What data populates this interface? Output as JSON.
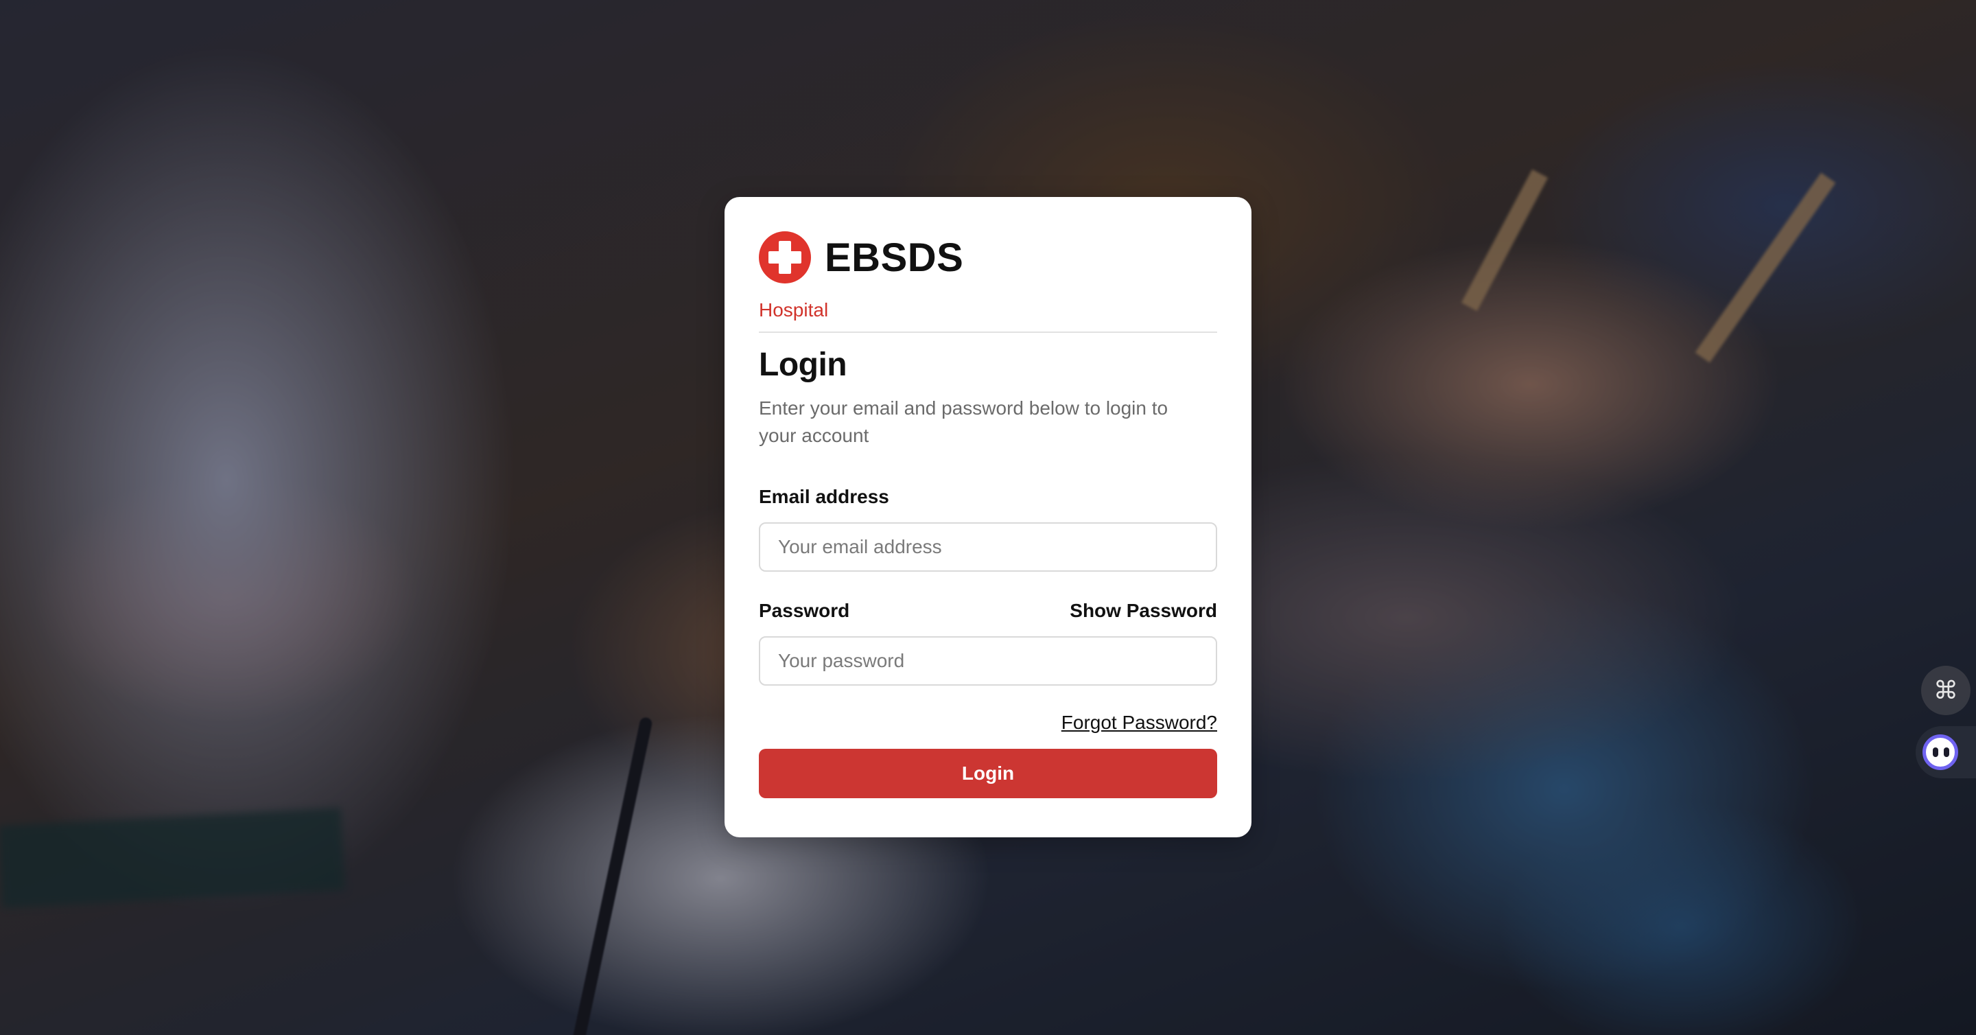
{
  "brand": {
    "name": "EBSDS",
    "subtitle": "Hospital",
    "logo_icon": "medical-cross-icon",
    "accent_color": "#e0342c"
  },
  "login": {
    "title": "Login",
    "description": "Enter your email and password below to login to your account",
    "email_label": "Email address",
    "email_placeholder": "Your email address",
    "email_value": "",
    "password_label": "Password",
    "show_password_label": "Show Password",
    "password_placeholder": "Your password",
    "password_value": "",
    "forgot_password_label": "Forgot Password?",
    "submit_label": "Login",
    "submit_color": "#cc3632"
  },
  "widgets": {
    "command_icon": "command-icon",
    "assistant_icon": "assistant-bot-icon"
  }
}
